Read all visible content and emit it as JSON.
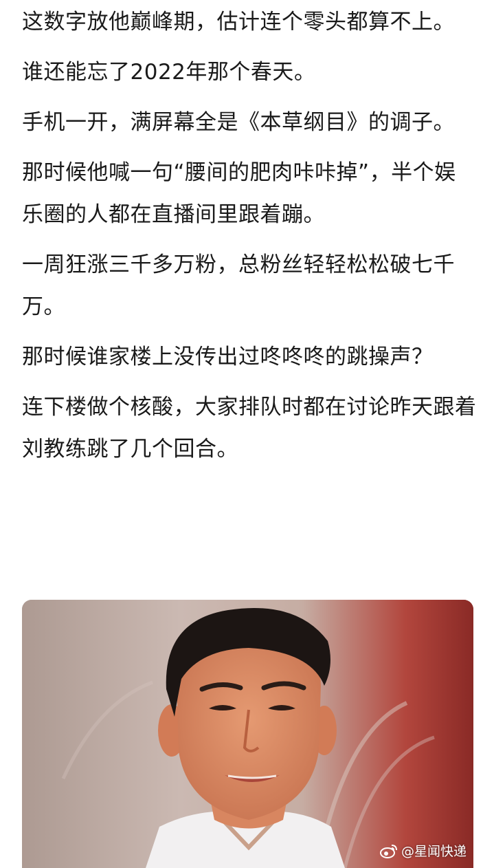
{
  "article": {
    "paragraphs": [
      "这数字放他巅峰期，估计连个零头都算不上。",
      "谁还能忘了2022年那个春天。",
      "手机一开，满屏幕全是《本草纲目》的调子。",
      "那时候他喊一句“腰间的肥肉咔咔掉”，半个娱乐圈的人都在直播间里跟着蹦。",
      "一周狂涨三千多万粉，总粉丝轻轻松松破七千万。",
      "那时候谁家楼上没传出过咚咚咚的跳操声？",
      "连下楼做个核酸，大家排队时都在讨论昨天跟着刘教练跳了几个回合。"
    ]
  },
  "image": {
    "watermark_text": "@星闻快递",
    "watermark_icon": "weibo-icon"
  },
  "colors": {
    "text": "#1a1a1a",
    "background": "#ffffff",
    "photo_wall": "#c8b4ab",
    "photo_red": "#b34940"
  }
}
